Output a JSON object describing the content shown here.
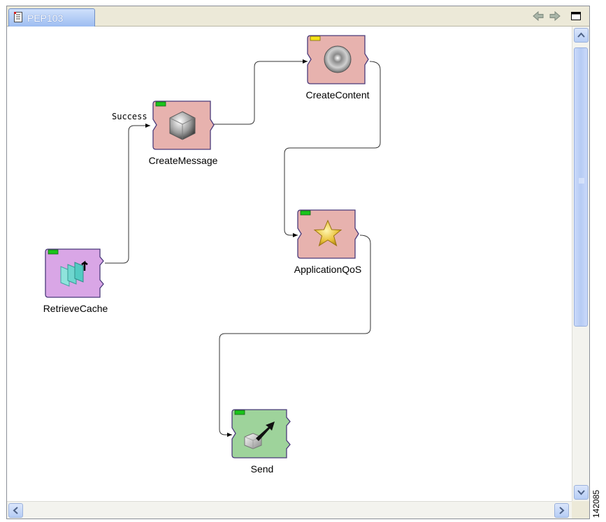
{
  "tab": {
    "title": "PEP103"
  },
  "toolbar": {
    "back_icon": "arrow-left-icon",
    "forward_icon": "arrow-right-icon",
    "maximize_icon": "maximize-icon"
  },
  "nodes": [
    {
      "id": "retrieve-cache",
      "label": "RetrieveCache",
      "color": "#d9a6e6",
      "status_color": "#19c419",
      "icon": "cache-pages-icon"
    },
    {
      "id": "create-message",
      "label": "CreateMessage",
      "color": "#e7b2ae",
      "status_color": "#19c419",
      "icon": "cube-icon"
    },
    {
      "id": "create-content",
      "label": "CreateContent",
      "color": "#e7b2ae",
      "status_color": "#f5e218",
      "icon": "sphere-icon"
    },
    {
      "id": "application-qos",
      "label": "ApplicationQoS",
      "color": "#e7b2ae",
      "status_color": "#19c419",
      "icon": "star-icon"
    },
    {
      "id": "send",
      "label": "Send",
      "color": "#9ed39b",
      "status_color": "#19c419",
      "icon": "send-arrow-icon"
    }
  ],
  "connections": [
    {
      "from": "RetrieveCache",
      "to": "CreateMessage",
      "label": "Success"
    },
    {
      "from": "CreateMessage",
      "to": "CreateContent",
      "label": ""
    },
    {
      "from": "CreateContent",
      "to": "ApplicationQoS",
      "label": ""
    },
    {
      "from": "ApplicationQoS",
      "to": "Send",
      "label": ""
    }
  ],
  "figure_number": "142085"
}
